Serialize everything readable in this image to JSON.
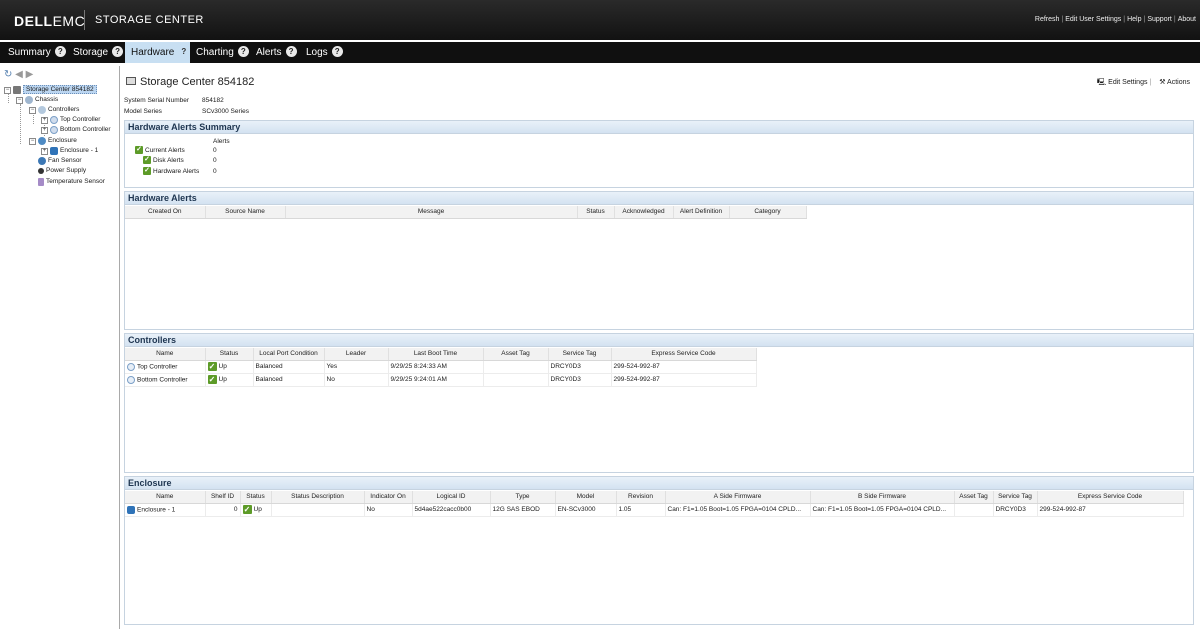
{
  "header": {
    "logo_main": "DELL",
    "logo_sub": "EMC",
    "product": "STORAGE CENTER",
    "links": [
      "Refresh",
      "Edit User Settings",
      "Help",
      "Support",
      "About"
    ]
  },
  "tabs": [
    {
      "label": "Summary",
      "help": "?"
    },
    {
      "label": "Storage",
      "help": "?"
    },
    {
      "label": "Hardware",
      "help": "?"
    },
    {
      "label": "Charting",
      "help": "?"
    },
    {
      "label": "Alerts",
      "help": "?"
    },
    {
      "label": "Logs",
      "help": "?"
    }
  ],
  "tree": {
    "root": "Storage Center 854182",
    "chassis": "Chassis",
    "controllers": "Controllers",
    "top_controller": "Top Controller",
    "bottom_controller": "Bottom Controller",
    "enclosure": "Enclosure",
    "enclosure1": "Enclosure - 1",
    "fan": "Fan Sensor",
    "power": "Power Supply",
    "temp": "Temperature Sensor"
  },
  "content": {
    "title": "Storage Center 854182",
    "edit_settings": "Edit Settings",
    "actions": "Actions",
    "serial_label": "System Serial Number",
    "serial_value": "854182",
    "model_label": "Model Series",
    "model_value": "SCv3000 Series"
  },
  "alerts_summary": {
    "title": "Hardware Alerts Summary",
    "col": "Alerts",
    "rows": [
      {
        "label": "Current Alerts",
        "value": "0"
      },
      {
        "label": "Disk Alerts",
        "value": "0"
      },
      {
        "label": "Hardware Alerts",
        "value": "0"
      }
    ]
  },
  "hardware_alerts": {
    "title": "Hardware Alerts",
    "columns": [
      "Created On",
      "Source Name",
      "Message",
      "Status",
      "Acknowledged",
      "Alert Definition",
      "Category"
    ]
  },
  "controllers": {
    "title": "Controllers",
    "columns": [
      "Name",
      "Status",
      "Local Port Condition",
      "Leader",
      "Last Boot Time",
      "Asset Tag",
      "Service Tag",
      "Express Service Code"
    ],
    "rows": [
      {
        "name": "Top Controller",
        "status": "Up",
        "port": "Balanced",
        "leader": "Yes",
        "boot": "9/29/25 8:24:33 AM",
        "asset": "",
        "service": "DRCY0D3",
        "express": "299-524-992-87"
      },
      {
        "name": "Bottom Controller",
        "status": "Up",
        "port": "Balanced",
        "leader": "No",
        "boot": "9/29/25 9:24:01 AM",
        "asset": "",
        "service": "DRCY0D3",
        "express": "299-524-992-87"
      }
    ]
  },
  "enclosure": {
    "title": "Enclosure",
    "columns": [
      "Name",
      "Shelf ID",
      "Status",
      "Status Description",
      "Indicator On",
      "Logical ID",
      "Type",
      "Model",
      "Revision",
      "A Side Firmware",
      "B Side Firmware",
      "Asset Tag",
      "Service Tag",
      "Express Service Code"
    ],
    "rows": [
      {
        "name": "Enclosure - 1",
        "shelf": "0",
        "status": "Up",
        "desc": "",
        "indicator": "No",
        "logical": "5d4ae522cacc0b00",
        "type": "12G SAS EBOD",
        "model": "EN-SCv3000",
        "revision": "1.05",
        "afw": "Can: F1=1.05 Boot=1.05 FPGA=0104 CPLD...",
        "bfw": "Can: F1=1.05 Boot=1.05 FPGA=0104 CPLD...",
        "asset": "",
        "service": "DRCY0D3",
        "express": "299-524-992-87"
      }
    ]
  }
}
